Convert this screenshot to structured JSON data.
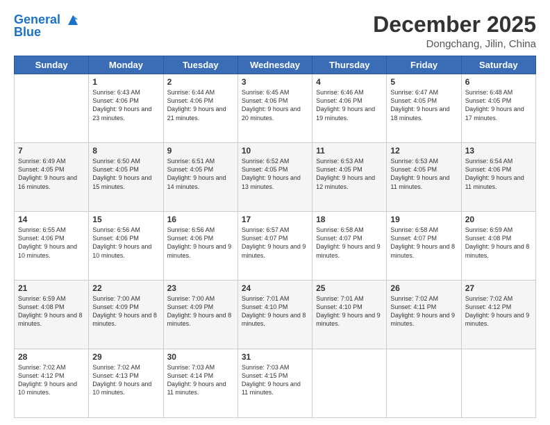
{
  "header": {
    "logo_line1": "General",
    "logo_line2": "Blue",
    "month_year": "December 2025",
    "location": "Dongchang, Jilin, China"
  },
  "days_of_week": [
    "Sunday",
    "Monday",
    "Tuesday",
    "Wednesday",
    "Thursday",
    "Friday",
    "Saturday"
  ],
  "weeks": [
    [
      {
        "day": "",
        "info": ""
      },
      {
        "day": "1",
        "info": "Sunrise: 6:43 AM\nSunset: 4:06 PM\nDaylight: 9 hours\nand 23 minutes."
      },
      {
        "day": "2",
        "info": "Sunrise: 6:44 AM\nSunset: 4:06 PM\nDaylight: 9 hours\nand 21 minutes."
      },
      {
        "day": "3",
        "info": "Sunrise: 6:45 AM\nSunset: 4:06 PM\nDaylight: 9 hours\nand 20 minutes."
      },
      {
        "day": "4",
        "info": "Sunrise: 6:46 AM\nSunset: 4:06 PM\nDaylight: 9 hours\nand 19 minutes."
      },
      {
        "day": "5",
        "info": "Sunrise: 6:47 AM\nSunset: 4:05 PM\nDaylight: 9 hours\nand 18 minutes."
      },
      {
        "day": "6",
        "info": "Sunrise: 6:48 AM\nSunset: 4:05 PM\nDaylight: 9 hours\nand 17 minutes."
      }
    ],
    [
      {
        "day": "7",
        "info": "Sunrise: 6:49 AM\nSunset: 4:05 PM\nDaylight: 9 hours\nand 16 minutes."
      },
      {
        "day": "8",
        "info": "Sunrise: 6:50 AM\nSunset: 4:05 PM\nDaylight: 9 hours\nand 15 minutes."
      },
      {
        "day": "9",
        "info": "Sunrise: 6:51 AM\nSunset: 4:05 PM\nDaylight: 9 hours\nand 14 minutes."
      },
      {
        "day": "10",
        "info": "Sunrise: 6:52 AM\nSunset: 4:05 PM\nDaylight: 9 hours\nand 13 minutes."
      },
      {
        "day": "11",
        "info": "Sunrise: 6:53 AM\nSunset: 4:05 PM\nDaylight: 9 hours\nand 12 minutes."
      },
      {
        "day": "12",
        "info": "Sunrise: 6:53 AM\nSunset: 4:05 PM\nDaylight: 9 hours\nand 11 minutes."
      },
      {
        "day": "13",
        "info": "Sunrise: 6:54 AM\nSunset: 4:06 PM\nDaylight: 9 hours\nand 11 minutes."
      }
    ],
    [
      {
        "day": "14",
        "info": "Sunrise: 6:55 AM\nSunset: 4:06 PM\nDaylight: 9 hours\nand 10 minutes."
      },
      {
        "day": "15",
        "info": "Sunrise: 6:56 AM\nSunset: 4:06 PM\nDaylight: 9 hours\nand 10 minutes."
      },
      {
        "day": "16",
        "info": "Sunrise: 6:56 AM\nSunset: 4:06 PM\nDaylight: 9 hours\nand 9 minutes."
      },
      {
        "day": "17",
        "info": "Sunrise: 6:57 AM\nSunset: 4:07 PM\nDaylight: 9 hours\nand 9 minutes."
      },
      {
        "day": "18",
        "info": "Sunrise: 6:58 AM\nSunset: 4:07 PM\nDaylight: 9 hours\nand 9 minutes."
      },
      {
        "day": "19",
        "info": "Sunrise: 6:58 AM\nSunset: 4:07 PM\nDaylight: 9 hours\nand 8 minutes."
      },
      {
        "day": "20",
        "info": "Sunrise: 6:59 AM\nSunset: 4:08 PM\nDaylight: 9 hours\nand 8 minutes."
      }
    ],
    [
      {
        "day": "21",
        "info": "Sunrise: 6:59 AM\nSunset: 4:08 PM\nDaylight: 9 hours\nand 8 minutes."
      },
      {
        "day": "22",
        "info": "Sunrise: 7:00 AM\nSunset: 4:09 PM\nDaylight: 9 hours\nand 8 minutes."
      },
      {
        "day": "23",
        "info": "Sunrise: 7:00 AM\nSunset: 4:09 PM\nDaylight: 9 hours\nand 8 minutes."
      },
      {
        "day": "24",
        "info": "Sunrise: 7:01 AM\nSunset: 4:10 PM\nDaylight: 9 hours\nand 8 minutes."
      },
      {
        "day": "25",
        "info": "Sunrise: 7:01 AM\nSunset: 4:10 PM\nDaylight: 9 hours\nand 9 minutes."
      },
      {
        "day": "26",
        "info": "Sunrise: 7:02 AM\nSunset: 4:11 PM\nDaylight: 9 hours\nand 9 minutes."
      },
      {
        "day": "27",
        "info": "Sunrise: 7:02 AM\nSunset: 4:12 PM\nDaylight: 9 hours\nand 9 minutes."
      }
    ],
    [
      {
        "day": "28",
        "info": "Sunrise: 7:02 AM\nSunset: 4:12 PM\nDaylight: 9 hours\nand 10 minutes."
      },
      {
        "day": "29",
        "info": "Sunrise: 7:02 AM\nSunset: 4:13 PM\nDaylight: 9 hours\nand 10 minutes."
      },
      {
        "day": "30",
        "info": "Sunrise: 7:03 AM\nSunset: 4:14 PM\nDaylight: 9 hours\nand 11 minutes."
      },
      {
        "day": "31",
        "info": "Sunrise: 7:03 AM\nSunset: 4:15 PM\nDaylight: 9 hours\nand 11 minutes."
      },
      {
        "day": "",
        "info": ""
      },
      {
        "day": "",
        "info": ""
      },
      {
        "day": "",
        "info": ""
      }
    ]
  ]
}
